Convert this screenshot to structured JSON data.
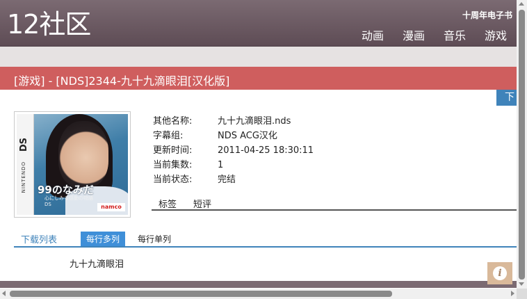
{
  "header": {
    "logo": "12社区",
    "ebook_link": "十周年电子书",
    "nav": [
      "动画",
      "漫画",
      "音乐",
      "游戏"
    ]
  },
  "title": "[游戏] - [NDS]2344-九十九滴眼泪[汉化版]",
  "download_button": "下",
  "cover": {
    "side_text": "DS",
    "side_brand": "NINTENDO",
    "title": "99のなみだ",
    "subtitle": "心にしみる感動の物語 DS",
    "publisher": "namco"
  },
  "info": [
    {
      "label": "其他名称:",
      "value": "九十九滴眼泪.nds"
    },
    {
      "label": "字幕组:",
      "value": "NDS ACG汉化"
    },
    {
      "label": "更新时间:",
      "value": "2011-04-25 18:30:11"
    },
    {
      "label": "当前集数:",
      "value": "1"
    },
    {
      "label": "当前状态:",
      "value": "完结"
    }
  ],
  "tabs": [
    "标签",
    "短评"
  ],
  "download_list": {
    "label": "下载列表",
    "multi": "每行多列",
    "single": "每行单列"
  },
  "files": [
    "九十九滴眼泪"
  ],
  "info_button": "i"
}
